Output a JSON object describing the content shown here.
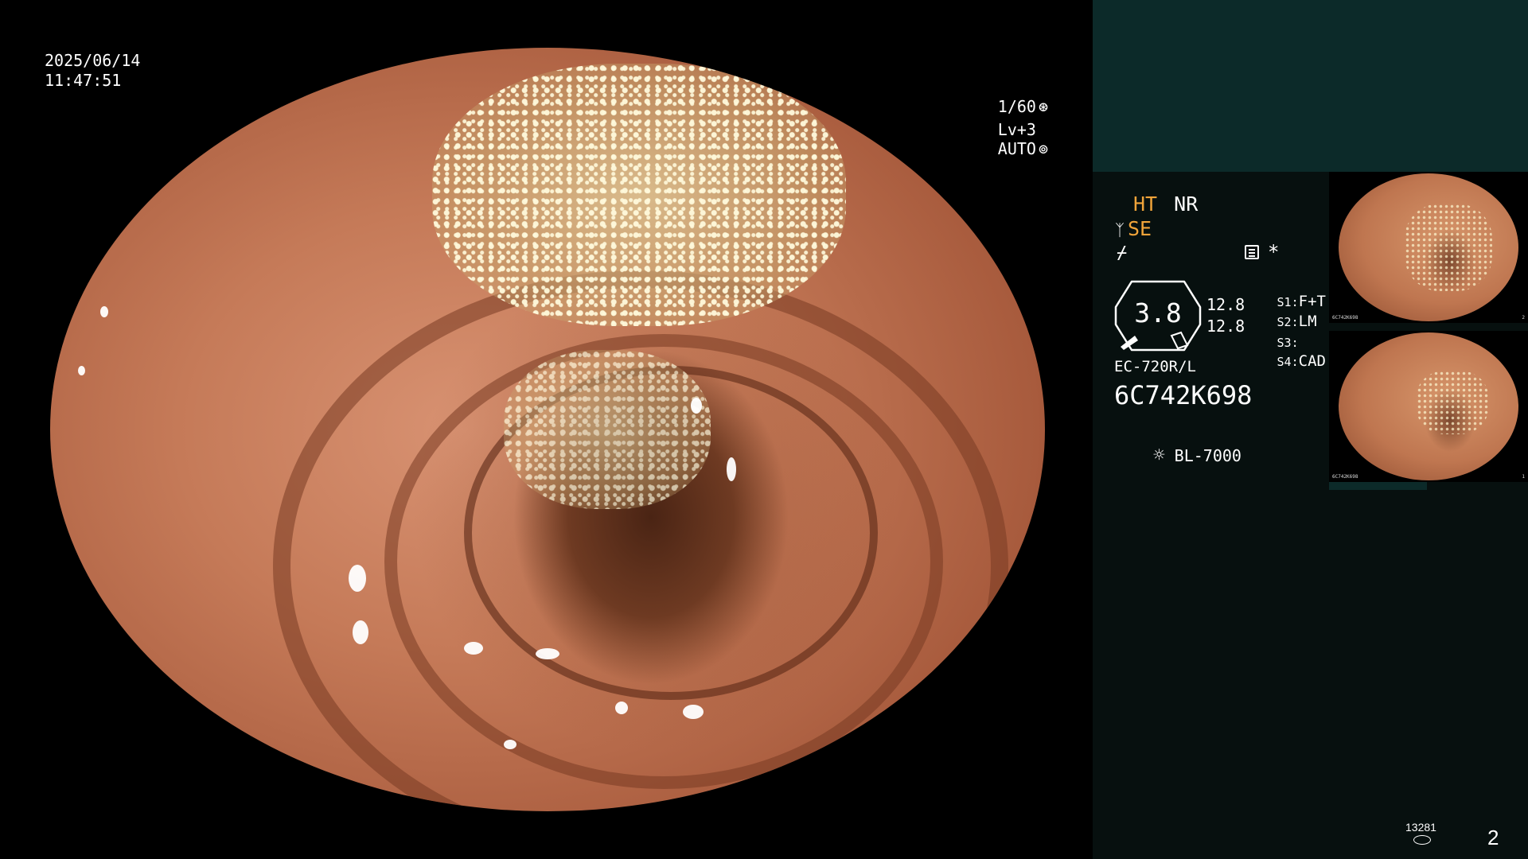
{
  "overlay": {
    "date": "2025/06/14",
    "time": "11:47:51",
    "shutter": "1/60",
    "level": "Lv+3",
    "exposure_mode": "AUTO"
  },
  "panel": {
    "ht": "HT",
    "nr": "NR",
    "se": "SE",
    "zoom_value": "3.8",
    "value_a": "12.8",
    "value_b": "12.8",
    "switches": [
      {
        "key": "S1:",
        "value": "F+T"
      },
      {
        "key": "S2:",
        "value": "LM"
      },
      {
        "key": "S3:",
        "value": ""
      },
      {
        "key": "S4:",
        "value": "CAD"
      }
    ],
    "scope_model": "EC-720R/L",
    "serial": "6C742K698",
    "light_source": "BL-7000",
    "counter": "13281",
    "page": "2",
    "asterisk": "*"
  },
  "thumbnails": [
    {
      "label": "6C742K698",
      "index": "2"
    },
    {
      "label": "6C742K698",
      "index": "1"
    }
  ],
  "colors": {
    "highlight": "#f0a43a",
    "panel_top": "#0c2a29",
    "panel_bg": "#07100f"
  }
}
